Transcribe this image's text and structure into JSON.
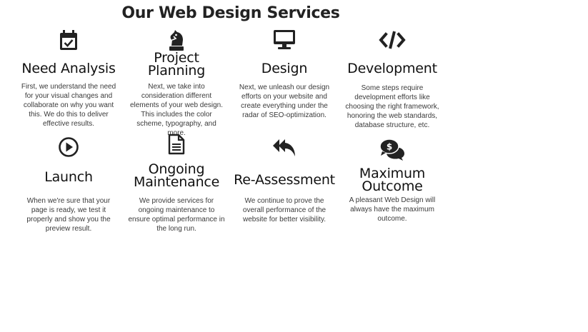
{
  "page": {
    "title": "Our Web Design Services"
  },
  "services": [
    {
      "title": "Need Analysis",
      "icon": "calendar-check-icon",
      "description": "First, we understand the need for your visual changes and collaborate on why you want this. We do this to deliver effective results."
    },
    {
      "title": "Project Planning",
      "icon": "chess-knight-icon",
      "description": "Next, we take into consideration different elements of your web design. This includes the color scheme, typography, and more."
    },
    {
      "title": "Design",
      "icon": "desktop-icon",
      "description": "Next, we unleash our design efforts on your website and create everything under the radar of SEO-optimization."
    },
    {
      "title": "Development",
      "icon": "code-icon",
      "description": "Some steps require development efforts like choosing the right framework, honoring the web standards, database structure, etc."
    },
    {
      "title": "Launch",
      "icon": "play-circle-icon",
      "description": "When we're sure that your page is ready, we test it properly and show you the preview result."
    },
    {
      "title": "Ongoing Maintenance",
      "icon": "file-text-icon",
      "description": "We provide services for ongoing maintenance to ensure optimal performance in the long run."
    },
    {
      "title": "Re-Assessment",
      "icon": "reply-all-icon",
      "description": "We continue to prove the overall performance of the website for better visibility."
    },
    {
      "title": "Maximum Outcome",
      "icon": "comments-dollar-icon",
      "description": "A pleasant Web Design will always have the maximum outcome."
    }
  ],
  "colors": {
    "icon": "#222222",
    "heading": "#111111",
    "body_text": "#3a3a3a"
  }
}
